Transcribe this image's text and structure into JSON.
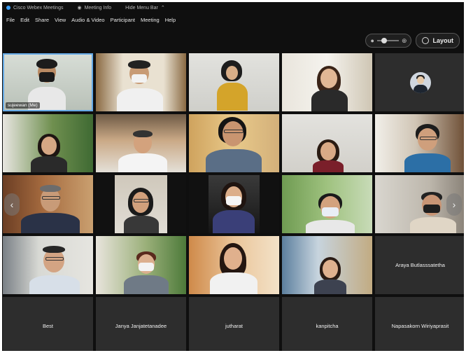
{
  "titlebar": {
    "app_name": "Cisco Webex Meetings",
    "meeting_info": "Meeting Info",
    "hide_menu_bar": "Hide Menu Bar"
  },
  "menu": {
    "file": "File",
    "edit": "Edit",
    "share": "Share",
    "view": "View",
    "audio_video": "Audio & Video",
    "participant": "Participant",
    "meeting": "Meeting",
    "help": "Help"
  },
  "toolbar": {
    "layout_label": "Layout"
  },
  "participants": {
    "self_name": "sujeewan (Me)",
    "name_tiles": [
      "Araya Butlasssatetha",
      "Best",
      "Janya Janjatetanadee",
      "jutharat",
      "kanpitcha",
      "Napasakorn Wiriyaprasit"
    ]
  }
}
